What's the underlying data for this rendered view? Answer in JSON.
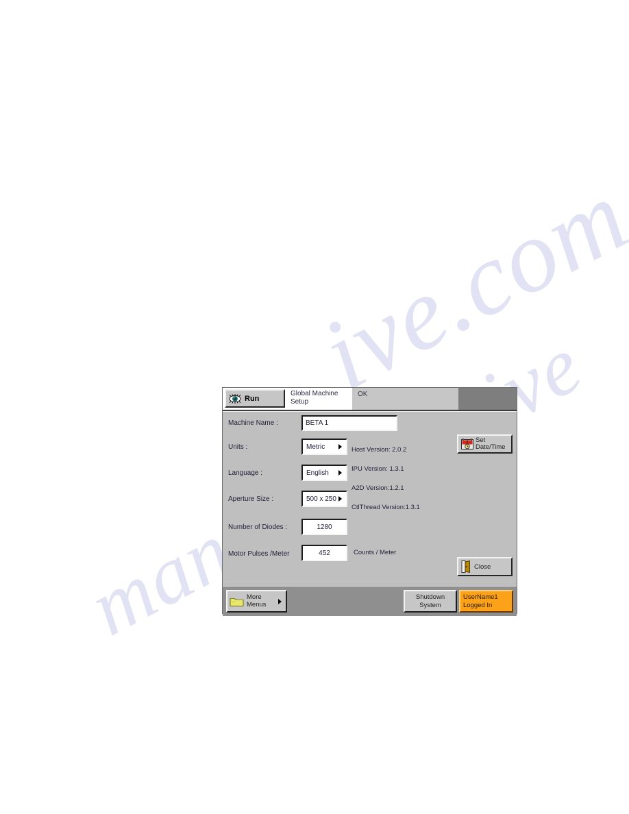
{
  "header": {
    "run_label": "Run",
    "run_icon": "eye-icon",
    "title": "Global Machine\nSetup",
    "title_line1": "Global Machine",
    "title_line2": "Setup",
    "status": "OK"
  },
  "form": {
    "machine_name": {
      "label": "Machine Name :",
      "value": "BETA 1"
    },
    "units": {
      "label": "Units :",
      "value": "Metric"
    },
    "language": {
      "label": "Language :",
      "value": "English"
    },
    "aperture": {
      "label": "Aperture Size :",
      "value": "500 x 250"
    },
    "diodes": {
      "label": "Number of Diodes :",
      "value": "1280"
    },
    "pulses": {
      "label": "Motor Pulses /Meter",
      "value": "452",
      "suffix": "Counts / Meter"
    }
  },
  "versions": [
    "Host Version: 2.0.2",
    "IPU Version: 1.3.1",
    "A2D Version:1.2.1",
    "CtlThread Version:1.3.1"
  ],
  "buttons": {
    "set_datetime_line1": "Set",
    "set_datetime_line2": "Date/Time",
    "set_datetime_icon": "calendar-icon",
    "close_label": "Close",
    "close_icon": "door-icon"
  },
  "footer": {
    "more_line1": "More",
    "more_line2": "Menus",
    "more_icon": "folder-icon",
    "shutdown_line1": "Shutdown",
    "shutdown_line2": "System",
    "user_line1": "UserName1",
    "user_line2": "Logged In"
  },
  "watermark": {
    "line_a": "ive.com",
    "line_b": "manualsarchive"
  },
  "colors": {
    "panel_bg": "#bfbfbf",
    "button_face": "#c6c6c6",
    "footer_bg": "#8f8f8f",
    "header_right": "#7e7e7e",
    "user_badge": "#fba21a",
    "folder_yellow": "#e8e86a",
    "eye_iris": "#0c7a78"
  }
}
